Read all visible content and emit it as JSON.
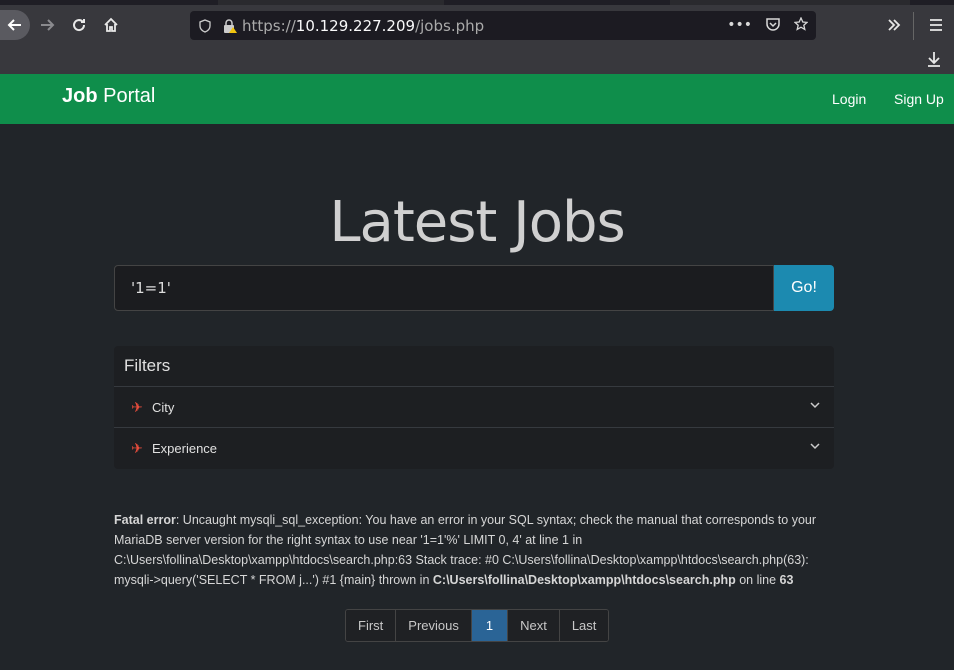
{
  "browser": {
    "url_scheme": "https://",
    "url_host": "10.129.227.209",
    "url_path": "/jobs.php"
  },
  "site": {
    "brand_bold": "Job",
    "brand_rest": "Portal",
    "nav": {
      "login": "Login",
      "signup": "Sign Up"
    }
  },
  "main": {
    "heading": "Latest Jobs",
    "search": {
      "value": "'1=1'",
      "button": "Go!"
    },
    "filters": {
      "title": "Filters",
      "items": [
        {
          "label": "City"
        },
        {
          "label": "Experience"
        }
      ]
    },
    "error": {
      "label": "Fatal error",
      "message": ": Uncaught mysqli_sql_exception: You have an error in your SQL syntax; check the manual that corresponds to your MariaDB server version for the right syntax to use near '1=1'%' LIMIT 0, 4' at line 1 in C:\\Users\\follina\\Desktop\\xampp\\htdocs\\search.php:63 Stack trace: #0 C:\\Users\\follina\\Desktop\\xampp\\htdocs\\search.php(63): mysqli->query('SELECT * FROM j...') #1 {main} thrown in ",
      "file": "C:\\Users\\follina\\Desktop\\xampp\\htdocs\\search.php",
      "on_line": " on line ",
      "line": "63"
    },
    "pagination": {
      "first": "First",
      "previous": "Previous",
      "current": "1",
      "next": "Next",
      "last": "Last"
    }
  }
}
